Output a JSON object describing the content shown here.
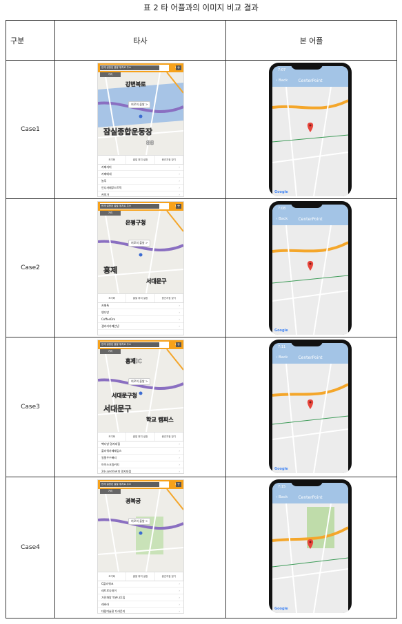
{
  "caption": "표 2 타 어플과의 이미지 비교 결과",
  "headers": {
    "col0": "구분",
    "col1": "타사",
    "col2": "본 어플"
  },
  "competitor_ui": {
    "search_placeholder": "검색할 출발지를 입력하세요",
    "search_button": "Q",
    "banner": "현재 설정된 출발 위치로 주소",
    "plus": "+",
    "chip": "거리",
    "pin_label": "여로의 출발 >",
    "tabs": [
      "조기화",
      "출발 위치 설정",
      "중간지점 찾기"
    ]
  },
  "our_app_ui": {
    "back_label": "Back",
    "title": "CenterPoint",
    "map_logo": "Google"
  },
  "cases": [
    {
      "label": "Case1",
      "time": "7:07",
      "list": [
        "카페자미",
        "카페베네",
        "놀루",
        "인디카페푸드트럭",
        "커피가"
      ],
      "map_labels": [
        "강변북로",
        "잠실종합운동장",
        "88"
      ]
    },
    {
      "label": "Case2",
      "time": "7:08",
      "list": [
        "카페톡",
        "앤다방",
        "CoffeeOro",
        "갤러리카페안녕"
      ],
      "map_labels": [
        "은평구청",
        "홍제",
        "서대문구"
      ]
    },
    {
      "label": "Case3",
      "time": "7:11",
      "list": [
        "빽다방 명지대점",
        "플라워카페제임스",
        "일렬우수빠리",
        "아이스크림커피",
        "24시코리아커피 명지대점"
      ],
      "map_labels": [
        "홍제IC",
        "서대문구",
        "학교 캠퍼스",
        "서대문구청"
      ]
    },
    {
      "label": "Case4",
      "time": "7:15",
      "list": [
        "C플라워코",
        "레트로나파이",
        "가진화랑 북촌나무집",
        "레바라",
        "대림미술관 디라운지"
      ],
      "map_labels": [
        "경복궁"
      ]
    }
  ],
  "colors": {
    "competitor_accent": "#f7a21b",
    "our_app_header": "#a3c4e6",
    "pin": "#e8453c",
    "road": "#f4a62a",
    "water": "#a7c4e6"
  }
}
